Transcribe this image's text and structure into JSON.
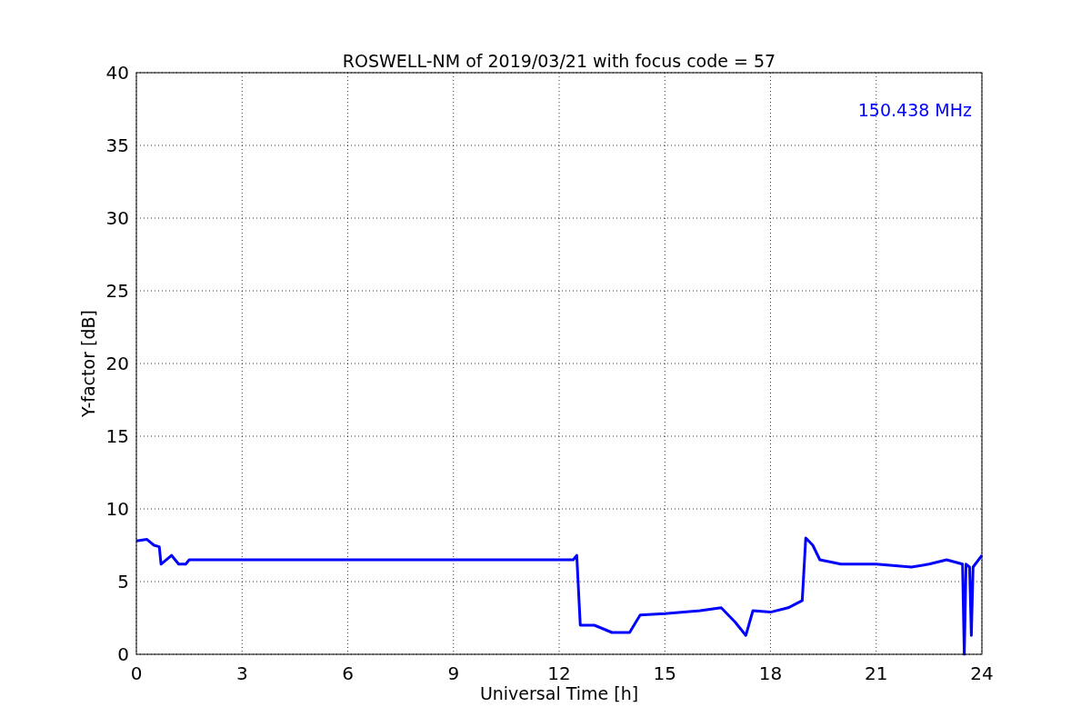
{
  "chart_data": {
    "type": "line",
    "title": "ROSWELL-NM of 2019/03/21 with focus code = 57",
    "xlabel": "Universal Time [h]",
    "ylabel": "Y-factor [dB]",
    "x": [
      0,
      0.3,
      0.5,
      0.65,
      0.7,
      1.0,
      1.2,
      1.4,
      1.5,
      12.4,
      12.5,
      12.6,
      13,
      13.5,
      14,
      14.3,
      15,
      16,
      16.6,
      17,
      17.3,
      17.5,
      18,
      18.5,
      18.9,
      19.0,
      19.2,
      19.4,
      20,
      21,
      22,
      22.5,
      23,
      23.45,
      23.5,
      23.55,
      23.65,
      23.7,
      23.75,
      24
    ],
    "series": [
      {
        "name": "150.438 MHz",
        "color": "#0000ff",
        "values": [
          7.8,
          7.9,
          7.5,
          7.4,
          6.2,
          6.8,
          6.2,
          6.2,
          6.5,
          6.5,
          6.8,
          2.0,
          2.0,
          1.5,
          1.5,
          2.7,
          2.8,
          3.0,
          3.2,
          2.2,
          1.3,
          3.0,
          2.9,
          3.2,
          3.7,
          8.0,
          7.5,
          6.5,
          6.2,
          6.2,
          6.0,
          6.2,
          6.5,
          6.2,
          0,
          6.2,
          6.0,
          1.3,
          6.0,
          6.8
        ]
      }
    ],
    "xlim": [
      0,
      24
    ],
    "ylim": [
      0,
      40
    ],
    "xticks": [
      0,
      3,
      6,
      9,
      12,
      15,
      18,
      21,
      24
    ],
    "yticks": [
      0,
      5,
      10,
      15,
      20,
      25,
      30,
      35,
      40
    ],
    "grid": true
  }
}
